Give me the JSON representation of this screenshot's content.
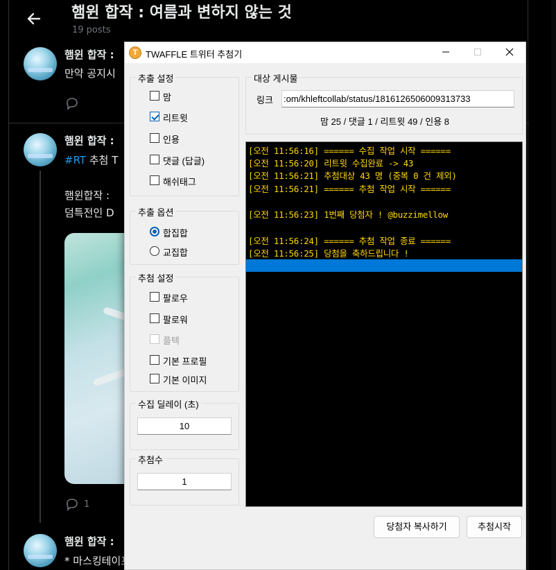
{
  "twitter": {
    "title": "햄윈 합작 : 여름과 변하지 않는 것",
    "post_count": "19 posts",
    "posts": [
      {
        "author": "햄윈 합작 :",
        "text": "만약 공지시"
      },
      {
        "author": "햄윈 합작 :",
        "hashtag": "#RT",
        "text": "추첨 T",
        "line2": "햄윈합작 :",
        "line3": "덤특전인 D",
        "reply_count": "1"
      },
      {
        "author": "햄윈 합작 :",
        "text": "* 마스킹테이프의 오타는 제작 시 수정 될 예정입니다."
      }
    ]
  },
  "dialog": {
    "app_icon_letter": "T",
    "title": "TWAFFLE 트위터 추첨기",
    "extract_settings": {
      "label": "추출 설정",
      "options": [
        {
          "label": "맘",
          "checked": false
        },
        {
          "label": "리트윗",
          "checked": true
        },
        {
          "label": "인용",
          "checked": false
        },
        {
          "label": "댓글 (답글)",
          "checked": false
        },
        {
          "label": "해쉬태그",
          "checked": false
        }
      ]
    },
    "extract_options": {
      "label": "추출 옵션",
      "options": [
        {
          "label": "합집합",
          "selected": true
        },
        {
          "label": "교집합",
          "selected": false
        }
      ]
    },
    "draw_settings": {
      "label": "추첨 설정",
      "options": [
        {
          "label": "팔로우",
          "checked": false,
          "disabled": false
        },
        {
          "label": "팔로워",
          "checked": false,
          "disabled": false
        },
        {
          "label": "플텍",
          "checked": false,
          "disabled": true
        },
        {
          "label": "기본 프로필",
          "checked": false,
          "disabled": false
        },
        {
          "label": "기본 이미지",
          "checked": false,
          "disabled": false
        }
      ]
    },
    "delay": {
      "label": "수집 딜레이 (초)",
      "value": "10"
    },
    "winner_count": {
      "label": "추첨수",
      "value": "1"
    },
    "target": {
      "label": "대상 게시물",
      "link_label": "링크",
      "link_value": ":om/khleftcollab/status/1816126506009313733",
      "stats": "맘 25 / 댓글 1 / 리트윗 49 / 인용 8"
    },
    "log": [
      "[오전 11:56:16] ====== 수집 작업 시작 ======",
      "[오전 11:56:20] 리트윗 수집완료 -> 43",
      "[오전 11:56:21] 추첨대상 43 명 (중복 0 건 제외)",
      "[오전 11:56:21] ====== 추첨 작업 시작 ======",
      "",
      "[오전 11:56:23] 1번째 당첨자 ! @buzzimellow",
      "",
      "[오전 11:56:24] ====== 추첨 작업 종료 ======",
      "[오전 11:56:25] 당첨을 축하드립니다 !"
    ],
    "buttons": {
      "copy": "당첨자 복사하기",
      "start": "추첨시작"
    }
  }
}
